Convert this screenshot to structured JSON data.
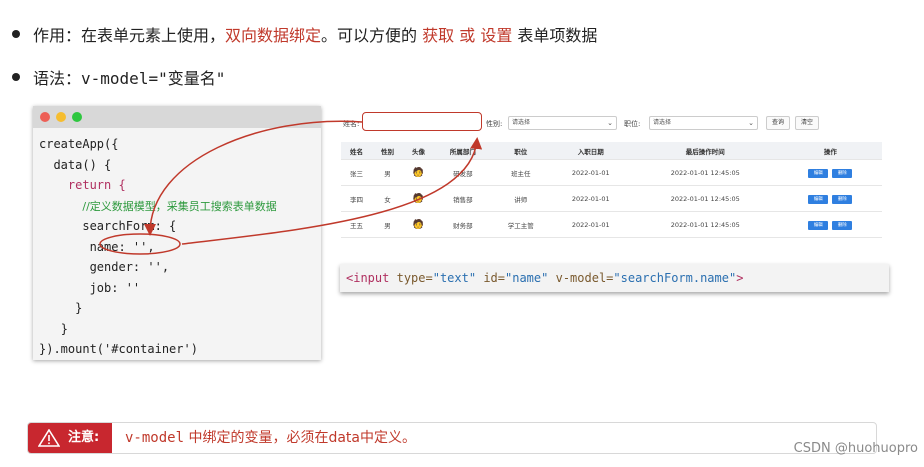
{
  "bullets": {
    "line1": {
      "prefix": "作用：在表单元素上使用，",
      "highlight1": "双向数据绑定",
      "middle": "。可以方便的 ",
      "highlight2": "获取",
      "or": " 或 ",
      "highlight3": "设置",
      "suffix": " 表单项数据"
    },
    "line2": {
      "prefix": "语法：",
      "code": "v-model=\"变量名\""
    }
  },
  "code_window": {
    "dots": [
      "#ed5f56",
      "#f6bd2f",
      "#2ec73f"
    ],
    "lines": [
      {
        "indent": "",
        "text": "createApp({",
        "kind": "plain"
      },
      {
        "indent": "  ",
        "text": "data() {",
        "kind": "plain"
      },
      {
        "indent": "    ",
        "text": "return {",
        "kind": "kw"
      },
      {
        "indent": "      ",
        "text": "//定义数据模型，采集员工搜索表单数据",
        "kind": "comment"
      },
      {
        "indent": "      ",
        "text": "searchForm: {",
        "kind": "plain"
      },
      {
        "indent": "       ",
        "text": "name: '',",
        "kind": "plain"
      },
      {
        "indent": "       ",
        "text": "gender: '',",
        "kind": "plain"
      },
      {
        "indent": "       ",
        "text": "job: ''",
        "kind": "plain"
      },
      {
        "indent": "     ",
        "text": "}",
        "kind": "plain"
      },
      {
        "indent": "   ",
        "text": "}",
        "kind": "plain"
      },
      {
        "indent": "",
        "text": "}).mount('#container')",
        "kind": "plain"
      }
    ]
  },
  "search_form": {
    "name_label": "姓名:",
    "gender_label": "性别:",
    "gender_placeholder": "请选择",
    "job_label": "职位:",
    "job_placeholder": "请选择",
    "query_button": "查询",
    "clear_button": "清空"
  },
  "table": {
    "headers": [
      "姓名",
      "性别",
      "头像",
      "所属部门",
      "职位",
      "入职日期",
      "最后操作时间",
      "操作"
    ],
    "rows": [
      {
        "name": "张三",
        "gender": "男",
        "dept": "研发部",
        "job": "班主任",
        "date": "2022-01-01",
        "updated": "2022-01-01 12:45:05"
      },
      {
        "name": "李四",
        "gender": "女",
        "dept": "销售部",
        "job": "讲师",
        "date": "2022-01-01",
        "updated": "2022-01-01 12:45:05"
      },
      {
        "name": "王五",
        "gender": "男",
        "dept": "财务部",
        "job": "学工主管",
        "date": "2022-01-01",
        "updated": "2022-01-01 12:45:05"
      }
    ],
    "edit_label": "编辑",
    "delete_label": "删除"
  },
  "snippet": {
    "open": "<input",
    "a1": "type=",
    "v1": "\"text\"",
    "a2": "id=",
    "v2": "\"name\"",
    "a3": "v-model=",
    "v3": "\"searchForm.name\"",
    "close": ">"
  },
  "notice": {
    "badge": "注意:",
    "code": "v-model",
    "message": " 中绑定的变量，必须在data中定义。"
  },
  "watermark": "CSDN @huohuopro",
  "colors": {
    "accent_red": "#c0392b",
    "badge_red": "#c8272f",
    "button_blue": "#2f7fe0"
  }
}
